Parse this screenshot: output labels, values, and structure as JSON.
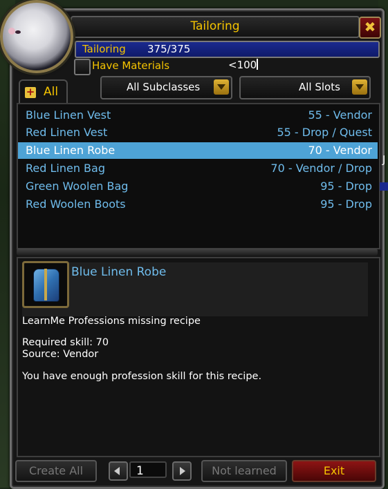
{
  "window": {
    "title": "Tailoring",
    "close_label": "✖"
  },
  "skill": {
    "label": "Tailoring",
    "value": "375/375",
    "fraction": 1.0
  },
  "filters": {
    "have_materials_label": "Have Materials",
    "have_materials_checked": false,
    "search_value": "<100",
    "tab_label": "All",
    "subclass_dropdown": "All Subclasses",
    "slot_dropdown": "All Slots"
  },
  "recipes": [
    {
      "name": "Blue Linen Vest",
      "source": "55 - Vendor"
    },
    {
      "name": "Red Linen Vest",
      "source": "55 - Drop / Quest"
    },
    {
      "name": "Blue Linen Robe",
      "source": "70 - Vendor",
      "selected": true
    },
    {
      "name": "Red Linen Bag",
      "source": "70 - Vendor / Drop"
    },
    {
      "name": "Green Woolen Bag",
      "source": "95 - Drop"
    },
    {
      "name": "Red Woolen Boots",
      "source": "95 - Drop"
    }
  ],
  "detail": {
    "item_name": "Blue Linen Robe",
    "line1": "LearnMe Professions missing recipe",
    "line2": "Required skill: 70",
    "line3": "Source: Vendor",
    "line4": "You have enough profession skill for this recipe."
  },
  "footer": {
    "create_all_label": "Create All",
    "page_value": "1",
    "not_learned_label": "Not learned",
    "exit_label": "Exit"
  },
  "side": {
    "glyph": "J"
  },
  "colors": {
    "gold": "#f5c400",
    "recipe_blue": "#6fbcec",
    "selected_bg": "#4ea3d6",
    "skillbar_blue": "#1a2a8f",
    "exit_red": "#8d1414"
  }
}
